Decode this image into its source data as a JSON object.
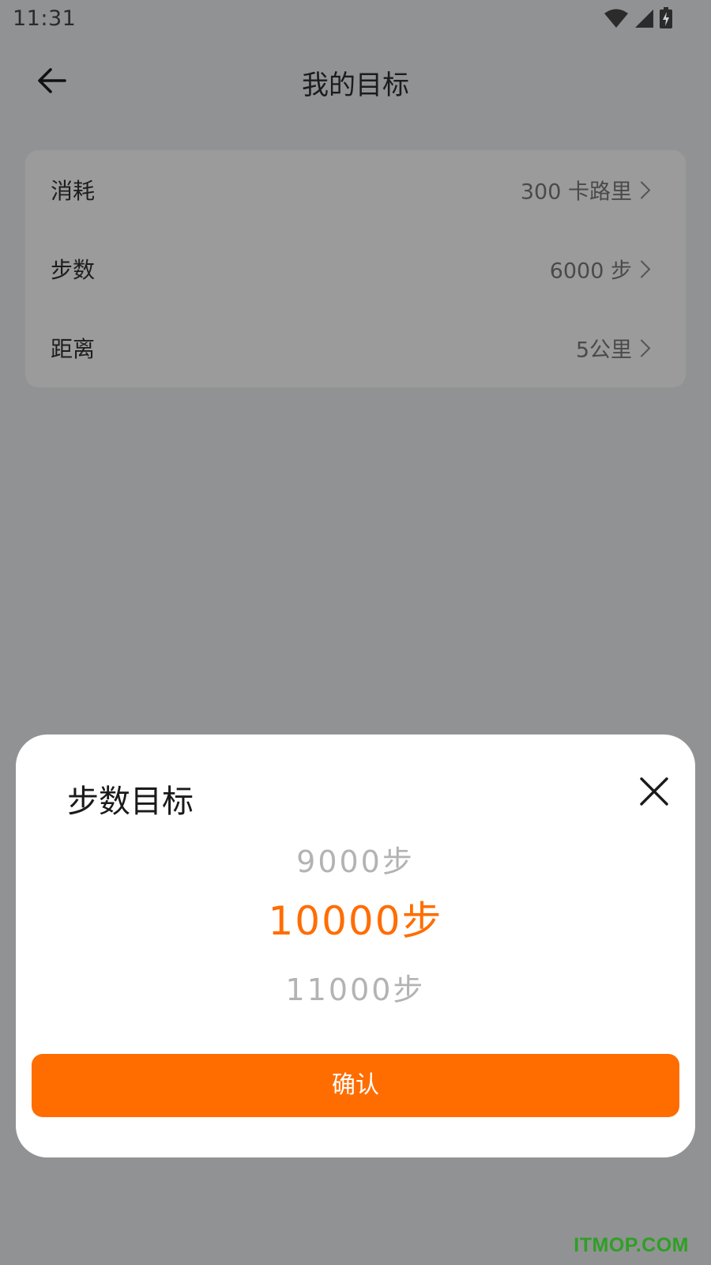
{
  "status_bar": {
    "time": "11:31",
    "icons": [
      "wifi-icon",
      "signal-icon",
      "battery-charging-icon"
    ]
  },
  "header": {
    "back_icon": "arrow-left-icon",
    "title": "我的目标"
  },
  "goals": [
    {
      "label": "消耗",
      "value": "300 卡路里"
    },
    {
      "label": "步数",
      "value": "6000 步"
    },
    {
      "label": "距离",
      "value": "5公里"
    }
  ],
  "sheet": {
    "title": "步数目标",
    "close_icon": "close-icon",
    "options": [
      "9000步",
      "10000步",
      "11000步"
    ],
    "selected_index": 1,
    "confirm_label": "确认"
  },
  "watermark": "ITMOP.COM",
  "colors": {
    "accent": "#ff6d00",
    "overlay": "#919294",
    "watermark": "#2ea023"
  }
}
